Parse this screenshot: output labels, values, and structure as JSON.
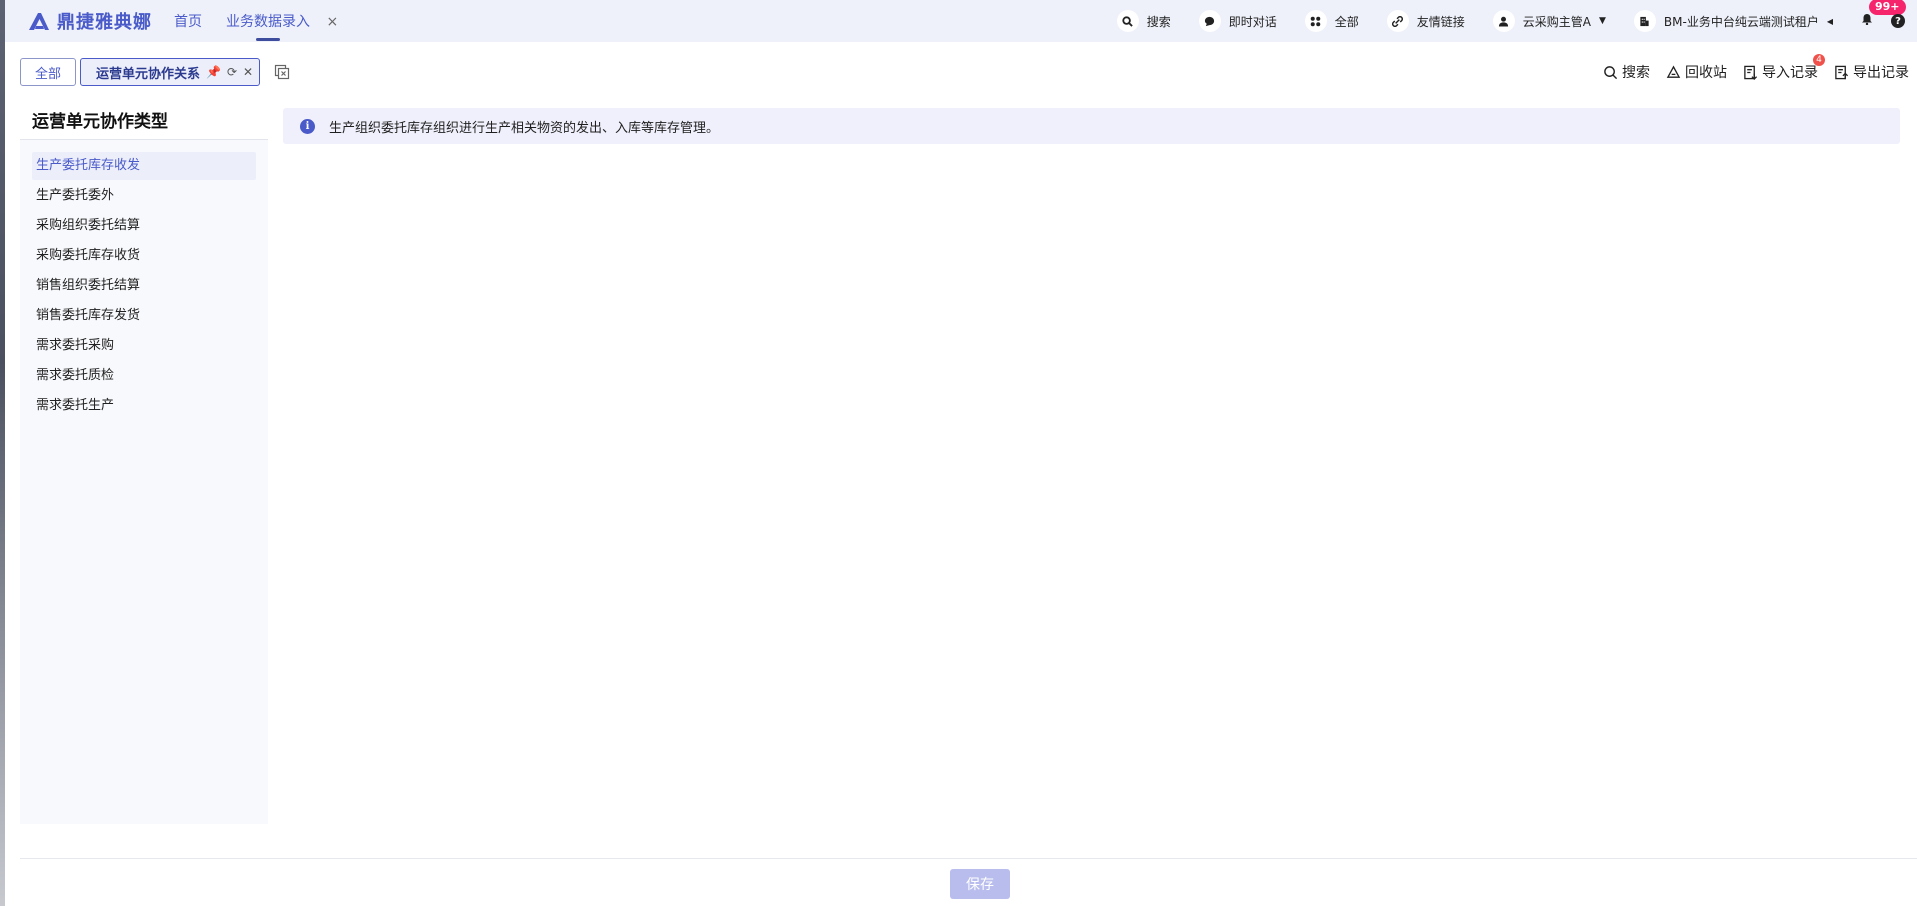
{
  "app": {
    "brand": "鼎捷雅典娜"
  },
  "nav": {
    "home": "首页",
    "current": "业务数据录入",
    "close": "×"
  },
  "topbar": {
    "search": "搜索",
    "chat": "即时对话",
    "all": "全部",
    "links": "友情链接",
    "user": "云采购主管A",
    "tenant": "BM-业务中台纯云端测试租户",
    "notify_badge": "99+",
    "help": "?"
  },
  "tabs": {
    "all": "全部",
    "current": "运营单元协作关系"
  },
  "actions": {
    "search": "搜索",
    "recycle": "回收站",
    "import": "导入记录",
    "import_badge": "4",
    "export": "导出记录"
  },
  "sidebar": {
    "title": "运营单元协作类型",
    "items": [
      {
        "label": "生产委托库存收发"
      },
      {
        "label": "生产委托委外"
      },
      {
        "label": "采购组织委托结算"
      },
      {
        "label": "采购委托库存收货"
      },
      {
        "label": "销售组织委托结算"
      },
      {
        "label": "销售委托库存发货"
      },
      {
        "label": "需求委托采购"
      },
      {
        "label": "需求委托质检"
      },
      {
        "label": "需求委托生产"
      }
    ]
  },
  "info": {
    "message": "生产组织委托库存组织进行生产相关物资的发出、入库等库存管理。"
  },
  "footer": {
    "save": "保存"
  }
}
